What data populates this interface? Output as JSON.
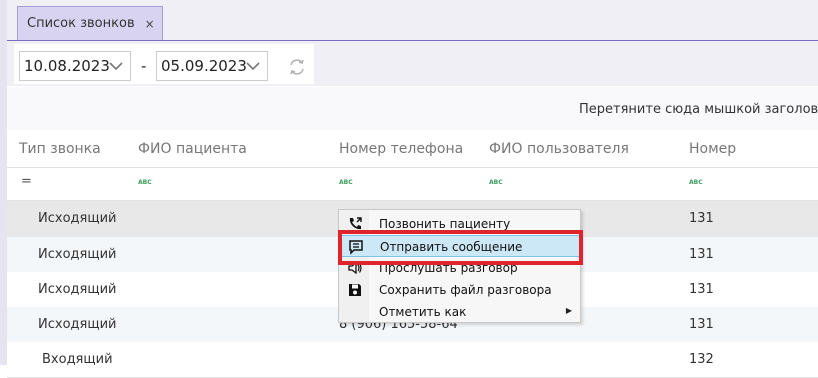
{
  "tab": {
    "label": "Список звонков",
    "close_glyph": "×"
  },
  "toolbar": {
    "date_from": "10.08.2023",
    "date_separator": "-",
    "date_to": "05.09.2023",
    "icons": {
      "date_chevron": "chevron-down-icon",
      "refresh": "refresh-icon"
    }
  },
  "group_hint": "Перетяните сюда мышкой заголовок ко",
  "columns": [
    "Тип звонка",
    "ФИО пациента",
    "Номер телефона",
    "ФИО пользователя",
    "Номер"
  ],
  "filter": {
    "equals_glyph": "=",
    "text_filter_glyph": "ABC"
  },
  "rows": [
    {
      "type": "Исходящий",
      "patient": "",
      "phone": "",
      "user": "",
      "number": "131"
    },
    {
      "type": "Исходящий",
      "patient": "",
      "phone": "",
      "user": "",
      "number": "131"
    },
    {
      "type": "Исходящий",
      "patient": "",
      "phone": "",
      "user": "",
      "number": "131"
    },
    {
      "type": "Исходящий",
      "patient": "",
      "phone": "8 (906) 165-58-64",
      "user": "",
      "number": "131"
    },
    {
      "type": "Входящий",
      "patient": "",
      "phone": "",
      "user": "",
      "number": "132"
    }
  ],
  "context_menu": {
    "items": [
      {
        "label": "Позвонить пациенту",
        "icon": "phone-call-icon"
      },
      {
        "label": "Отправить сообщение",
        "icon": "message-icon",
        "state": "hovered"
      },
      {
        "label": "Прослушать разговор",
        "icon": "speaker-icon"
      },
      {
        "label": "Сохранить файл разговора",
        "icon": "save-icon"
      },
      {
        "label": "Отметить как",
        "icon": "",
        "submenu": true
      }
    ]
  },
  "colors": {
    "tab_bg": "#d9d3f2",
    "accent": "#7a6cc0",
    "selected_row": "#e8e8e8",
    "alt_row": "#f4f7fa",
    "menu_hover": "#cce8f6",
    "highlight": "#e0242b"
  }
}
